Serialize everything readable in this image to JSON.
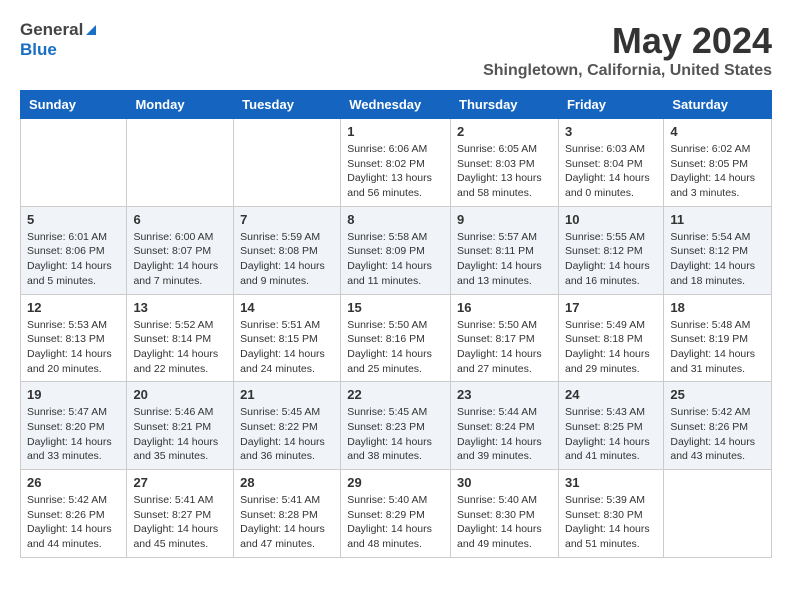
{
  "header": {
    "logo_general": "General",
    "logo_blue": "Blue",
    "month": "May 2024",
    "location": "Shingletown, California, United States"
  },
  "weekdays": [
    "Sunday",
    "Monday",
    "Tuesday",
    "Wednesday",
    "Thursday",
    "Friday",
    "Saturday"
  ],
  "weeks": [
    [
      {
        "day": "",
        "content": ""
      },
      {
        "day": "",
        "content": ""
      },
      {
        "day": "",
        "content": ""
      },
      {
        "day": "1",
        "content": "Sunrise: 6:06 AM\nSunset: 8:02 PM\nDaylight: 13 hours\nand 56 minutes."
      },
      {
        "day": "2",
        "content": "Sunrise: 6:05 AM\nSunset: 8:03 PM\nDaylight: 13 hours\nand 58 minutes."
      },
      {
        "day": "3",
        "content": "Sunrise: 6:03 AM\nSunset: 8:04 PM\nDaylight: 14 hours\nand 0 minutes."
      },
      {
        "day": "4",
        "content": "Sunrise: 6:02 AM\nSunset: 8:05 PM\nDaylight: 14 hours\nand 3 minutes."
      }
    ],
    [
      {
        "day": "5",
        "content": "Sunrise: 6:01 AM\nSunset: 8:06 PM\nDaylight: 14 hours\nand 5 minutes."
      },
      {
        "day": "6",
        "content": "Sunrise: 6:00 AM\nSunset: 8:07 PM\nDaylight: 14 hours\nand 7 minutes."
      },
      {
        "day": "7",
        "content": "Sunrise: 5:59 AM\nSunset: 8:08 PM\nDaylight: 14 hours\nand 9 minutes."
      },
      {
        "day": "8",
        "content": "Sunrise: 5:58 AM\nSunset: 8:09 PM\nDaylight: 14 hours\nand 11 minutes."
      },
      {
        "day": "9",
        "content": "Sunrise: 5:57 AM\nSunset: 8:11 PM\nDaylight: 14 hours\nand 13 minutes."
      },
      {
        "day": "10",
        "content": "Sunrise: 5:55 AM\nSunset: 8:12 PM\nDaylight: 14 hours\nand 16 minutes."
      },
      {
        "day": "11",
        "content": "Sunrise: 5:54 AM\nSunset: 8:12 PM\nDaylight: 14 hours\nand 18 minutes."
      }
    ],
    [
      {
        "day": "12",
        "content": "Sunrise: 5:53 AM\nSunset: 8:13 PM\nDaylight: 14 hours\nand 20 minutes."
      },
      {
        "day": "13",
        "content": "Sunrise: 5:52 AM\nSunset: 8:14 PM\nDaylight: 14 hours\nand 22 minutes."
      },
      {
        "day": "14",
        "content": "Sunrise: 5:51 AM\nSunset: 8:15 PM\nDaylight: 14 hours\nand 24 minutes."
      },
      {
        "day": "15",
        "content": "Sunrise: 5:50 AM\nSunset: 8:16 PM\nDaylight: 14 hours\nand 25 minutes."
      },
      {
        "day": "16",
        "content": "Sunrise: 5:50 AM\nSunset: 8:17 PM\nDaylight: 14 hours\nand 27 minutes."
      },
      {
        "day": "17",
        "content": "Sunrise: 5:49 AM\nSunset: 8:18 PM\nDaylight: 14 hours\nand 29 minutes."
      },
      {
        "day": "18",
        "content": "Sunrise: 5:48 AM\nSunset: 8:19 PM\nDaylight: 14 hours\nand 31 minutes."
      }
    ],
    [
      {
        "day": "19",
        "content": "Sunrise: 5:47 AM\nSunset: 8:20 PM\nDaylight: 14 hours\nand 33 minutes."
      },
      {
        "day": "20",
        "content": "Sunrise: 5:46 AM\nSunset: 8:21 PM\nDaylight: 14 hours\nand 35 minutes."
      },
      {
        "day": "21",
        "content": "Sunrise: 5:45 AM\nSunset: 8:22 PM\nDaylight: 14 hours\nand 36 minutes."
      },
      {
        "day": "22",
        "content": "Sunrise: 5:45 AM\nSunset: 8:23 PM\nDaylight: 14 hours\nand 38 minutes."
      },
      {
        "day": "23",
        "content": "Sunrise: 5:44 AM\nSunset: 8:24 PM\nDaylight: 14 hours\nand 39 minutes."
      },
      {
        "day": "24",
        "content": "Sunrise: 5:43 AM\nSunset: 8:25 PM\nDaylight: 14 hours\nand 41 minutes."
      },
      {
        "day": "25",
        "content": "Sunrise: 5:42 AM\nSunset: 8:26 PM\nDaylight: 14 hours\nand 43 minutes."
      }
    ],
    [
      {
        "day": "26",
        "content": "Sunrise: 5:42 AM\nSunset: 8:26 PM\nDaylight: 14 hours\nand 44 minutes."
      },
      {
        "day": "27",
        "content": "Sunrise: 5:41 AM\nSunset: 8:27 PM\nDaylight: 14 hours\nand 45 minutes."
      },
      {
        "day": "28",
        "content": "Sunrise: 5:41 AM\nSunset: 8:28 PM\nDaylight: 14 hours\nand 47 minutes."
      },
      {
        "day": "29",
        "content": "Sunrise: 5:40 AM\nSunset: 8:29 PM\nDaylight: 14 hours\nand 48 minutes."
      },
      {
        "day": "30",
        "content": "Sunrise: 5:40 AM\nSunset: 8:30 PM\nDaylight: 14 hours\nand 49 minutes."
      },
      {
        "day": "31",
        "content": "Sunrise: 5:39 AM\nSunset: 8:30 PM\nDaylight: 14 hours\nand 51 minutes."
      },
      {
        "day": "",
        "content": ""
      }
    ]
  ]
}
